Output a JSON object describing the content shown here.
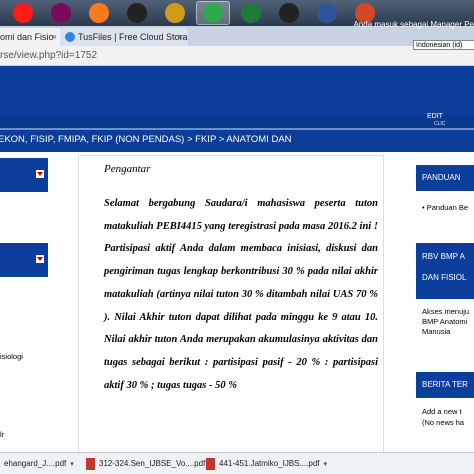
{
  "taskbar": {
    "items": [
      {
        "name": "app-1",
        "color": "#ff1a1a",
        "active": false
      },
      {
        "name": "app-2",
        "color": "#7a0a5a",
        "active": false
      },
      {
        "name": "firefox",
        "color": "#ff7a1a",
        "active": false
      },
      {
        "name": "video",
        "color": "#222222",
        "active": false
      },
      {
        "name": "media",
        "color": "#d09b1a",
        "active": false
      },
      {
        "name": "chrome",
        "color": "#2fa84f",
        "active": true
      },
      {
        "name": "excel",
        "color": "#1f7a3c",
        "active": false
      },
      {
        "name": "amazon",
        "color": "#222222",
        "active": false
      },
      {
        "name": "word",
        "color": "#2b579a",
        "active": false
      },
      {
        "name": "powerpoint",
        "color": "#d24726",
        "active": false
      }
    ]
  },
  "browser": {
    "tab1": "omi dan Fisio",
    "tab2": "TusFiles | Free Cloud Stora",
    "url": "rse/view.php?id=1752"
  },
  "header": {
    "login_text": "Anda masuk sebagai Manager Pe",
    "language": "Indonesian (id)",
    "edit": "EDIT",
    "edit_sub": "CLIC"
  },
  "breadcrumb": "EKON, FISIP, FMIPA, FKIP (NON PENDAS) > FKIP > ANATOMI DAN",
  "left": {
    "fragment": "isiologi",
    "fragment2": "lr"
  },
  "main": {
    "heading": "Pengantar",
    "paragraph": "Selamat bergabung Saudara/i mahasiswa peserta tuton matakuliah PEBI4415 yang teregistrasi pada masa 2016.2 ini ! Partisipasi aktif Anda dalam membaca inisiasi, diskusi dan pengiriman tugas lengkap berkontribusi 30 % pada nilai akhir matakuliah (artinya nilai tuton 30 % ditambah nilai UAS 70 % ). Nilai Akhir tuton dapat dilihat pada minggu ke 9 atau 10. Nilai akhir tuton Anda merupakan akumulasinya aktivitas dan tugas sebagai berikut : partisipasi pasif - 20 % : partisipasi aktif 30 % ; tugas tugas - 50 %"
  },
  "right": {
    "panduan_title": "PANDUAN",
    "panduan_item": "Panduan Be",
    "rbv_title_1": "RBV BMP A",
    "rbv_title_2": "DAN FISIOL",
    "rbv_text_1": "Akses menuju",
    "rbv_text_2": "BMP Anatomi",
    "rbv_text_3": "Manusia",
    "berita_title": "BERITA TER",
    "berita_item_1": "Add a new t",
    "berita_item_2": "(No news ha"
  },
  "downloads": [
    "ehangard_J....pdf",
    "312-324.Sen_IJBSE_Vo....pdf",
    "441-451.Jatmiko_IJBS....pdf"
  ]
}
